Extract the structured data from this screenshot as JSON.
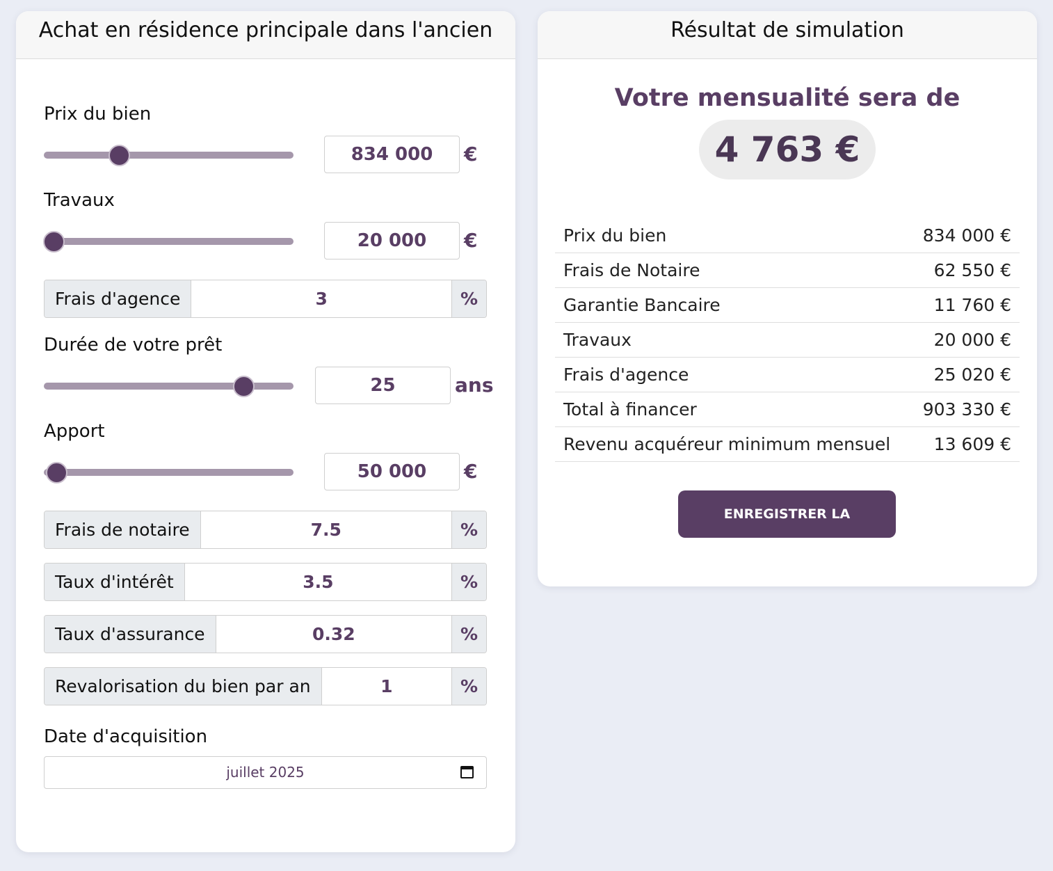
{
  "form": {
    "title": "Achat en résidence principale dans l'ancien",
    "prix_bien": {
      "label": "Prix du bien",
      "value": "834 000",
      "unit": "€",
      "slider_fraction": 0.3
    },
    "travaux": {
      "label": "Travaux",
      "value": "20 000",
      "unit": "€",
      "slider_fraction": 0.04
    },
    "frais_agence": {
      "label": "Frais d'agence",
      "value": "3",
      "unit": "%"
    },
    "duree": {
      "label": "Durée de votre prêt",
      "value": "25",
      "unit": "ans",
      "slider_fraction": 0.8
    },
    "apport": {
      "label": "Apport",
      "value": "50 000",
      "unit": "€",
      "slider_fraction": 0.05
    },
    "frais_notaire": {
      "label": "Frais de notaire",
      "value": "7.5",
      "unit": "%"
    },
    "taux_interet": {
      "label": "Taux d'intérêt",
      "value": "3.5",
      "unit": "%"
    },
    "taux_assurance": {
      "label": "Taux d'assurance",
      "value": "0.32",
      "unit": "%"
    },
    "revalorisation": {
      "label": "Revalorisation du bien par an",
      "value": "1",
      "unit": "%"
    },
    "date_acquisition": {
      "label": "Date d'acquisition",
      "value": "juillet 2025"
    }
  },
  "result": {
    "title": "Résultat de simulation",
    "headline": "Votre mensualité sera de",
    "monthly": "4 763 €",
    "rows": [
      {
        "label": "Prix du bien",
        "value": "834 000 €"
      },
      {
        "label": "Frais de Notaire",
        "value": "62 550 €"
      },
      {
        "label": "Garantie Bancaire",
        "value": "11 760 €"
      },
      {
        "label": "Travaux",
        "value": "20 000 €"
      },
      {
        "label": "Frais d'agence",
        "value": "25 020 €"
      },
      {
        "label": "Total à financer",
        "value": "903 330 €"
      },
      {
        "label": "Revenu acquéreur minimum mensuel",
        "value": "13 609 €"
      }
    ],
    "save_label": "ENREGISTRER LA SIMULATION"
  },
  "colors": {
    "accent": "#593e64",
    "background": "#eaedf5"
  }
}
